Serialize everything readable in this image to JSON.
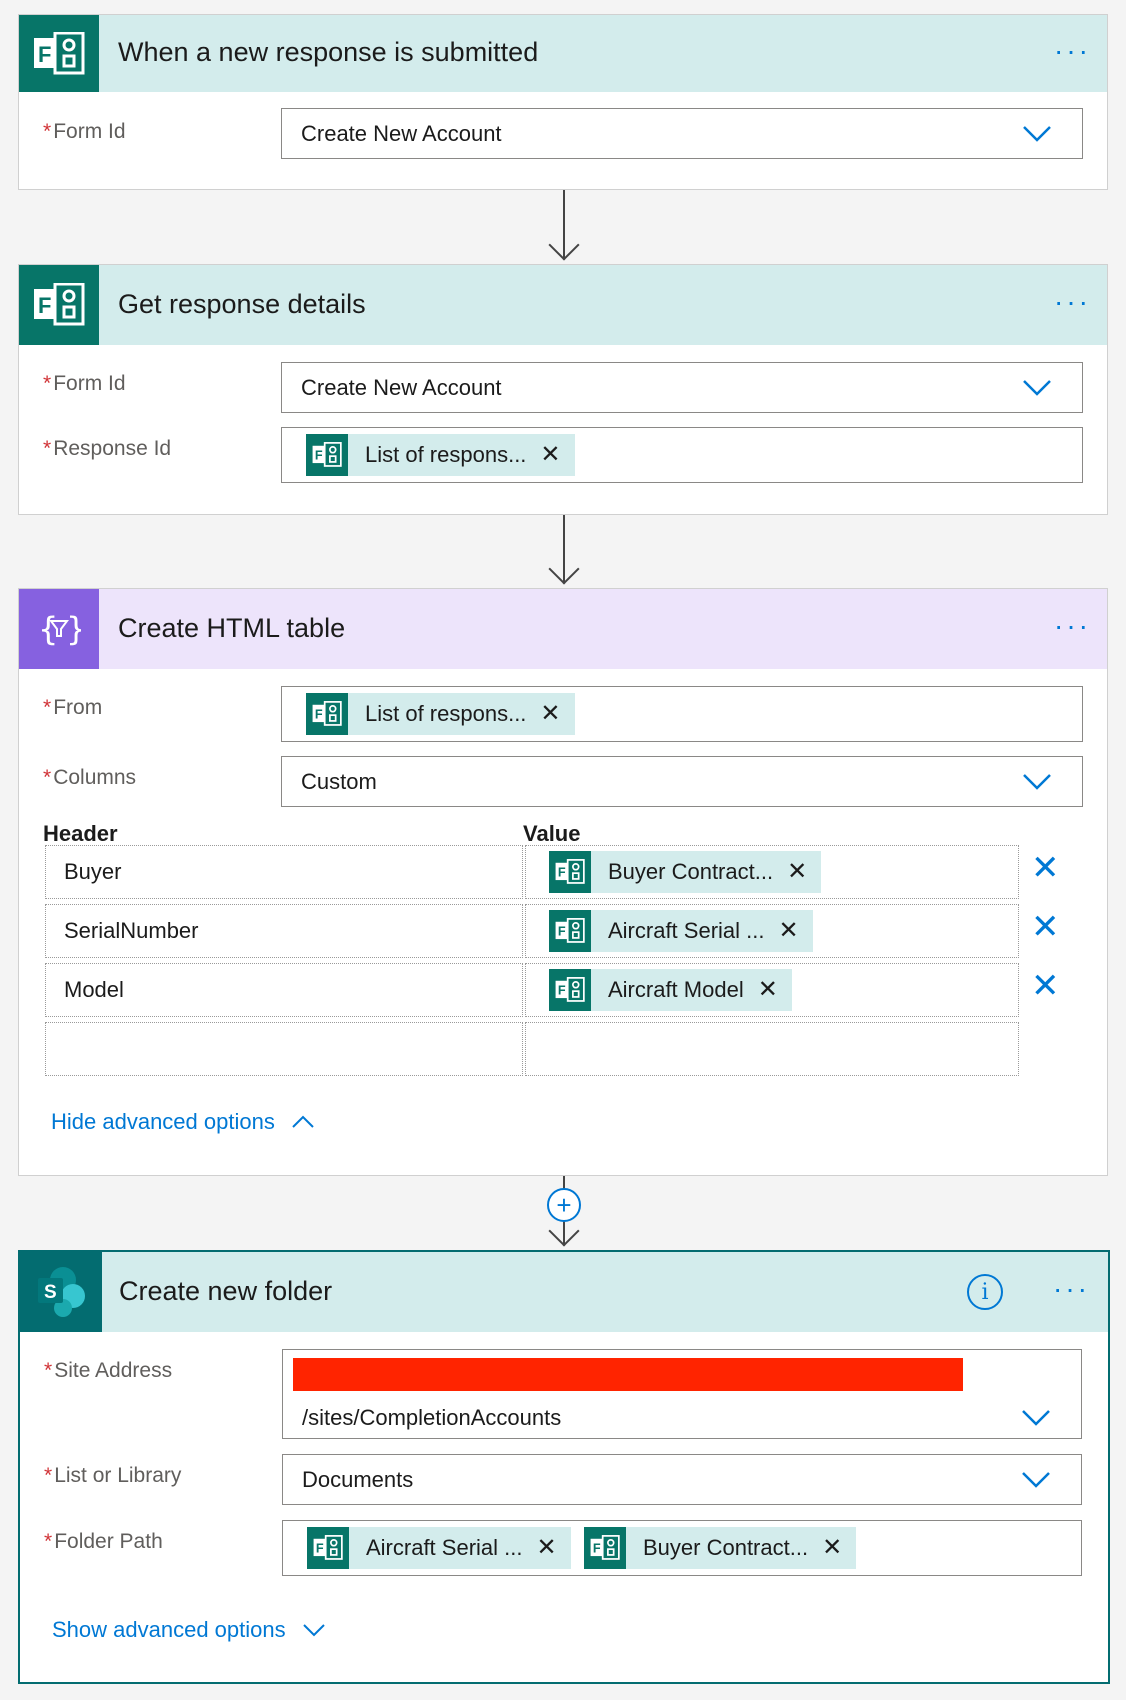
{
  "step1": {
    "title": "When a new response is submitted",
    "more": "···",
    "form_id_label": "Form Id",
    "form_id_value": "Create New Account"
  },
  "step2": {
    "title": "Get response details",
    "more": "···",
    "form_id_label": "Form Id",
    "form_id_value": "Create New Account",
    "response_id_label": "Response Id",
    "response_token": "List of respons..."
  },
  "step3": {
    "title": "Create HTML table",
    "more": "···",
    "from_label": "From",
    "from_token": "List of respons...",
    "columns_label": "Columns",
    "columns_value": "Custom",
    "header_col": "Header",
    "value_col": "Value",
    "rows": [
      {
        "header": "Buyer",
        "token": "Buyer Contract..."
      },
      {
        "header": "SerialNumber",
        "token": "Aircraft Serial ..."
      },
      {
        "header": "Model",
        "token": "Aircraft Model"
      }
    ],
    "advanced_link": "Hide advanced options"
  },
  "step4": {
    "title": "Create new folder",
    "more": "···",
    "info": "i",
    "site_label": "Site Address",
    "site_value": "/sites/CompletionAccounts",
    "list_label": "List or Library",
    "list_value": "Documents",
    "folder_label": "Folder Path",
    "folder_tokens": [
      "Aircraft Serial ...",
      "Buyer Contract..."
    ],
    "advanced_link": "Show advanced options"
  },
  "common": {
    "required_mark": "*",
    "remove_mark": "✕",
    "add_mark": "+"
  },
  "colors": {
    "accent": "#0078d4",
    "forms": "#077568",
    "html_purple": "#8661e0",
    "sharepoint": "#036c70",
    "redaction": "#ff2400"
  }
}
